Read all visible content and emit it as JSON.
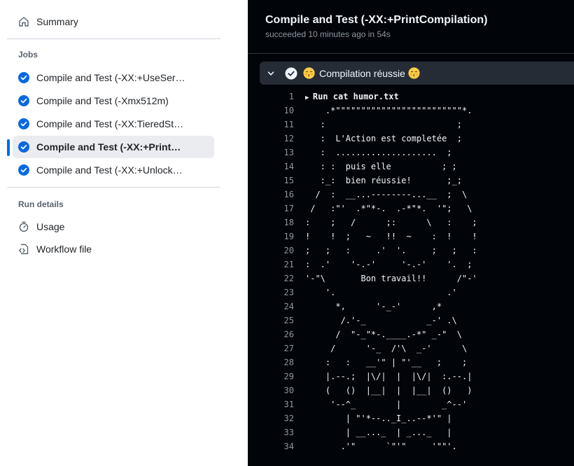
{
  "sidebar": {
    "summary_label": "Summary",
    "jobs_title": "Jobs",
    "jobs": [
      {
        "label": "Compile and Test (-XX:+UseSer…",
        "status": "success",
        "active": false
      },
      {
        "label": "Compile and Test (-Xmx512m)",
        "status": "success",
        "active": false
      },
      {
        "label": "Compile and Test (-XX:TieredSt…",
        "status": "success",
        "active": false
      },
      {
        "label": "Compile and Test (-XX:+Print…",
        "status": "success",
        "active": true
      },
      {
        "label": "Compile and Test (-XX:+Unlock…",
        "status": "success",
        "active": false
      }
    ],
    "run_details_title": "Run details",
    "usage_label": "Usage",
    "workflow_label": "Workflow file"
  },
  "header": {
    "title": "Compile and Test (-XX:+PrintCompilation)",
    "subtitle": "succeeded 10 minutes ago in 54s"
  },
  "step": {
    "title": "Compilation réussie",
    "status": "success"
  },
  "colors": {
    "accent": "#0969da",
    "log_bg": "#010409",
    "step_bg": "#262c36"
  },
  "log": {
    "lines": [
      {
        "n": "1",
        "t": "Run cat humor.txt",
        "collapsed": true
      },
      {
        "n": "10",
        "t": "    .*\"\"\"\"\"\"\"\"\"\"\"\"\"\"\"\"\"\"\"\"\"\"\"\"\"*."
      },
      {
        "n": "11",
        "t": "   :                          ;"
      },
      {
        "n": "12",
        "t": "   :  L'Action est completée  ;"
      },
      {
        "n": "13",
        "t": "   :  ....................  ;"
      },
      {
        "n": "14",
        "t": "   : :  puis elle          ; ;"
      },
      {
        "n": "15",
        "t": "   :_:  bien réussie!       ;_;"
      },
      {
        "n": "16",
        "t": "  /  :  __...--------...__  ;  \\"
      },
      {
        "n": "17",
        "t": " /   :\"'  .*\"*-.  .-*\"*.  '\";   \\"
      },
      {
        "n": "18",
        "t": ":    ;   /      ;:      \\   :    ;"
      },
      {
        "n": "19",
        "t": "!    !  ;   ~   !!  ~    :  !    !"
      },
      {
        "n": "20",
        "t": ";   ;   :     .'  '.     ;   ;   :"
      },
      {
        "n": "21",
        "t": ":  .'    '-.-'     '-.-'    '.  ;"
      },
      {
        "n": "22",
        "t": "'-\"\\       Bon travail!!      /\"-'"
      },
      {
        "n": "23",
        "t": "    '.                      .'"
      },
      {
        "n": "24",
        "t": "      *,      '-_-'      ,*"
      },
      {
        "n": "25",
        "t": "       /.'-_            _-' .\\"
      },
      {
        "n": "26",
        "t": "      /  \"-_\"*-.____.-*\" _-\"  \\"
      },
      {
        "n": "27",
        "t": "     /      '-_  /'\\  _-'      \\"
      },
      {
        "n": "28",
        "t": "    :   :   __'\" | \"'__   ;    ;"
      },
      {
        "n": "29",
        "t": "    |.--.;  |\\/|  |  |\\/|  :.--.|"
      },
      {
        "n": "30",
        "t": "    (   ()  |__|  |  |__|  ()   )"
      },
      {
        "n": "31",
        "t": "     '--^_        |        _^--'"
      },
      {
        "n": "32",
        "t": "        | \"'*--.._I_..--*'\" |"
      },
      {
        "n": "33",
        "t": "        | __..._  | _..._   |"
      },
      {
        "n": "34",
        "t": "       .'\"      `\"'\"     '\"\"'."
      }
    ]
  }
}
